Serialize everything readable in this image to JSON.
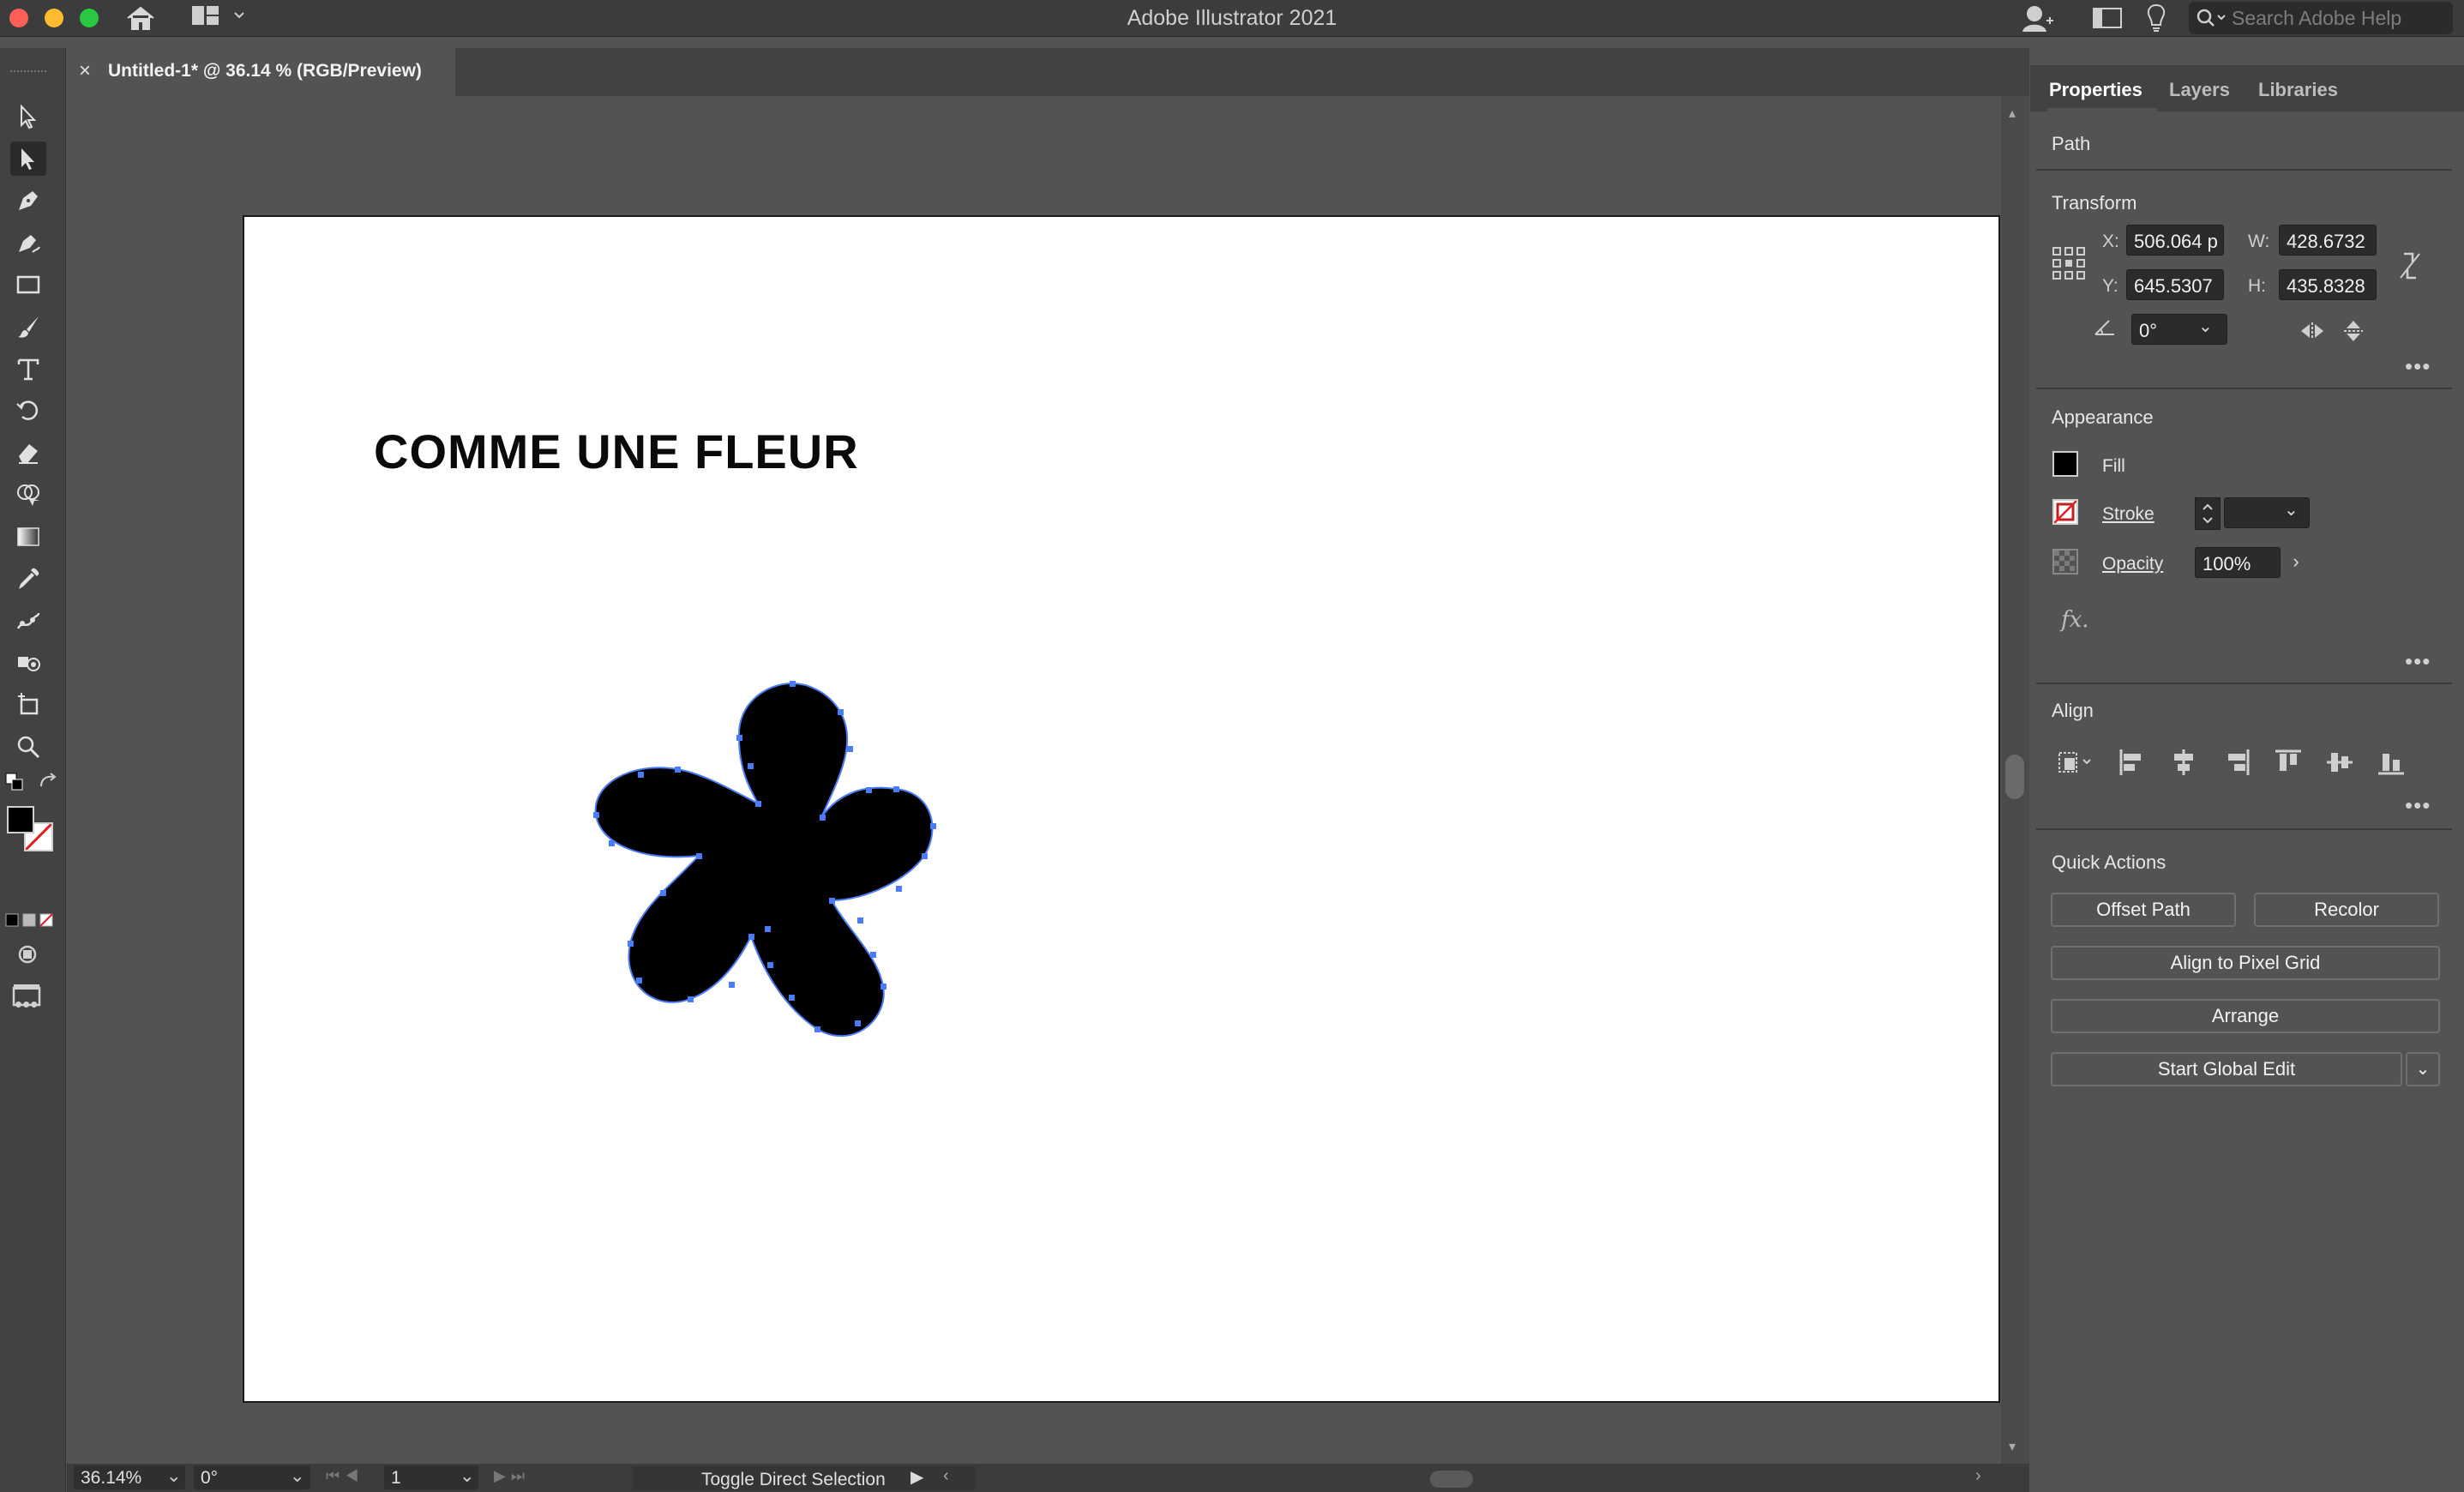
{
  "window": {
    "title": "Adobe Illustrator 2021",
    "search_placeholder": "Search Adobe Help",
    "traffic_lights": {
      "close": "#fe5f57",
      "minimize": "#febc2e",
      "zoom": "#28c840"
    }
  },
  "document_tab": {
    "label": "Untitled-1* @ 36.14 % (RGB/Preview)",
    "close_glyph": "×"
  },
  "toolbar": {
    "tools": [
      "selection-tool",
      "direct-selection-tool",
      "pen-tool",
      "curvature-tool",
      "rectangle-tool",
      "paintbrush-tool",
      "type-tool",
      "rotate-tool",
      "eraser-tool",
      "shape-builder-tool",
      "gradient-tool",
      "eyedropper-tool",
      "puppet-warp-tool",
      "symbol-sprayer-tool",
      "artboard-tool",
      "zoom-tool"
    ],
    "active_tool": "direct-selection-tool",
    "fill_color": "#000000",
    "stroke_color": "none",
    "more_glyph": "•••"
  },
  "canvas": {
    "heading_text": "COMME UNE FLEUR",
    "shape_fill": "#000000",
    "selection_color": "#4a7cf7"
  },
  "statusbar": {
    "zoom": "36.14%",
    "rotation": "0°",
    "artboard_number": "1",
    "status_text": "Toggle Direct Selection"
  },
  "panel": {
    "tabs": [
      "Properties",
      "Layers",
      "Libraries"
    ],
    "active_tab": "Properties",
    "selection_type": "Path",
    "transform": {
      "title": "Transform",
      "x_label": "X:",
      "x_value": "506.064 p",
      "y_label": "Y:",
      "y_value": "645.5307",
      "w_label": "W:",
      "w_value": "428.6732",
      "h_label": "H:",
      "h_value": "435.8328",
      "angle_value": "0°"
    },
    "appearance": {
      "title": "Appearance",
      "fill_label": "Fill",
      "stroke_label": "Stroke",
      "opacity_label": "Opacity",
      "opacity_value": "100%",
      "fx_label": "fx."
    },
    "align": {
      "title": "Align"
    },
    "quick_actions": {
      "title": "Quick Actions",
      "offset_path": "Offset Path",
      "recolor": "Recolor",
      "align_pixel_grid": "Align to Pixel Grid",
      "arrange": "Arrange",
      "start_global_edit": "Start Global Edit"
    },
    "more_glyph": "•••"
  }
}
